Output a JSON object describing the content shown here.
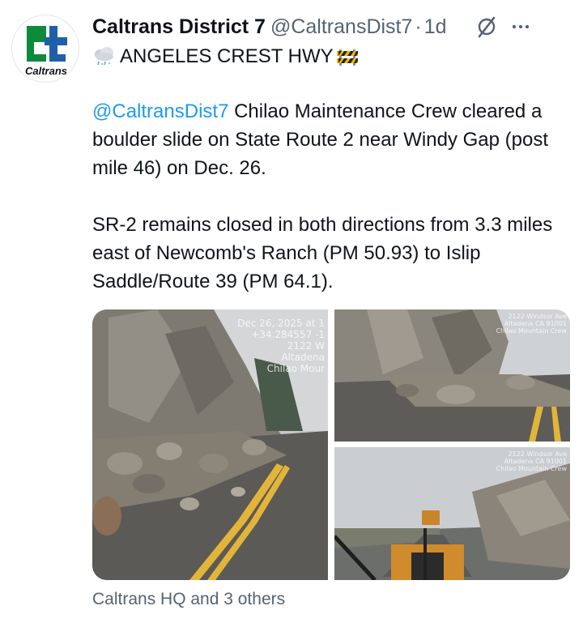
{
  "author": {
    "display_name": "Caltrans District 7",
    "handle": "@CaltransDist7",
    "separator": "·",
    "time": "1d",
    "avatar_logo_text": "Caltrans"
  },
  "headline": {
    "icon_left": "cloud-rain-snow-icon",
    "text": "ANGELES CREST HWY",
    "icon_right": "construction-barrier-icon"
  },
  "body": {
    "mention": "@CaltransDist7",
    "paragraph1_rest": " Chilao Maintenance Crew cleared a boulder slide on State Route 2 near Windy Gap (post mile 46) on Dec. 26.",
    "paragraph2": "SR-2 remains closed in both directions from 3.3 miles east of Newcomb's Ranch (PM 50.93) to Islip Saddle/Route 39 (PM 64.1)."
  },
  "media": {
    "photo1_stamp": [
      "Dec 26, 2025 at 1",
      "+34.284557 -1",
      "2122 W",
      "Altadena",
      "Chilao Mour"
    ],
    "photo2_stamp": [
      "2122 Windsor Ave",
      "Altadena CA 91001",
      "Chilao Mountain Crew"
    ],
    "photo3_stamp": [
      "2122 Windsor Ave",
      "Altadena CA 91001",
      "Chilao Mountain Crew"
    ]
  },
  "footer": {
    "liked_by": "Caltrans HQ and 3 others"
  },
  "colors": {
    "text": "#0f1419",
    "secondary": "#536471",
    "link": "#1d9bf0",
    "caltrans_green": "#0d8a3a",
    "caltrans_blue": "#1f5fa8"
  }
}
